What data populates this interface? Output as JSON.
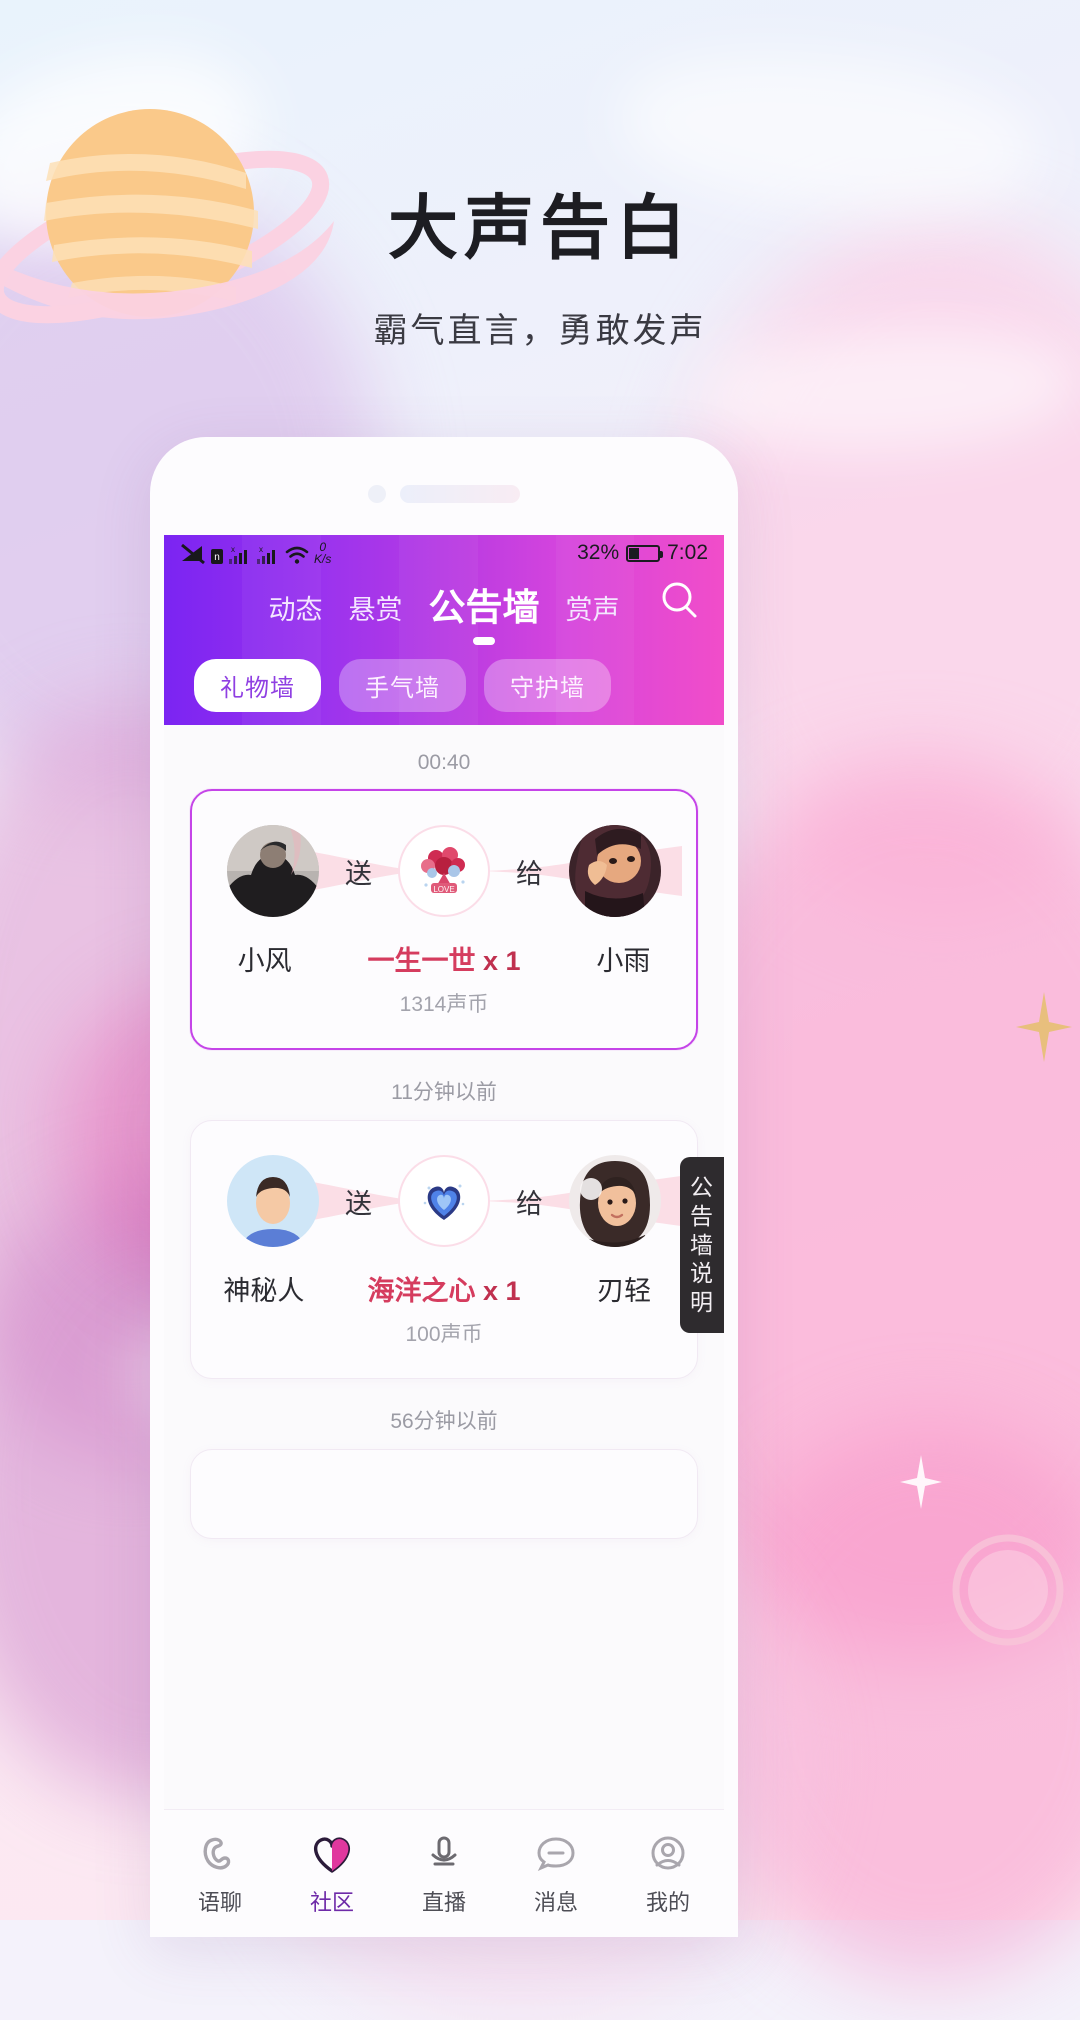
{
  "poster": {
    "headline": "大声告白",
    "subheadline": "霸气直言，勇敢发声"
  },
  "colors": {
    "header_start": "#7b24f2",
    "header_end": "#f14dc9",
    "accent_gift": "#d53c5e",
    "chip_active_text": "#8f3fe2",
    "active_tab": "#6e2aa8",
    "card_highlight_border": "#c544e8",
    "sidetab_bg": "#2e2b2e"
  },
  "statusbar": {
    "icons": [
      "signal-off-icon",
      "data-icon",
      "signal-bars-1-icon",
      "signal-bars-2-icon",
      "wifi-icon"
    ],
    "net_speed": "0",
    "net_speed_unit": "K/s",
    "battery_percent": "32%",
    "battery_icon": "battery-icon",
    "time": "7:02"
  },
  "header": {
    "tabs": [
      {
        "label": "动态",
        "active": false
      },
      {
        "label": "悬赏",
        "active": false
      },
      {
        "label": "公告墙",
        "active": true
      },
      {
        "label": "赏声",
        "active": false
      }
    ],
    "search_icon": "search-icon",
    "chips": [
      {
        "label": "礼物墙",
        "active": true
      },
      {
        "label": "手气墙",
        "active": false
      },
      {
        "label": "守护墙",
        "active": false
      }
    ]
  },
  "side_tab": {
    "chars": [
      "公",
      "告",
      "墙",
      "说",
      "明"
    ]
  },
  "feed": [
    {
      "timestamp": "00:40",
      "highlight": true,
      "sender": "小风",
      "sender_avatar": "avatar-photo-man",
      "verb_send": "送",
      "verb_to": "给",
      "gift_icon": "gift-bouquet-icon",
      "gift_name": "一生一世",
      "gift_qty": "x 1",
      "gift_cost": "1314声币",
      "receiver": "小雨",
      "receiver_avatar": "avatar-photo-woman"
    },
    {
      "timestamp": "11分钟以前",
      "highlight": false,
      "sender": "神秘人",
      "sender_avatar": "avatar-default-man",
      "verb_send": "送",
      "verb_to": "给",
      "gift_icon": "gift-heart-icon",
      "gift_name": "海洋之心",
      "gift_qty": "x 1",
      "gift_cost": "100声币",
      "receiver": "刃轻",
      "receiver_avatar": "avatar-photo-curly"
    }
  ],
  "feed_trailing_timestamp": "56分钟以前",
  "bottom_nav": [
    {
      "label": "语聊",
      "icon": "voice-call-icon",
      "active": false
    },
    {
      "label": "社区",
      "icon": "heart-icon",
      "active": true
    },
    {
      "label": "直播",
      "icon": "microphone-icon",
      "active": false
    },
    {
      "label": "消息",
      "icon": "message-icon",
      "active": false
    },
    {
      "label": "我的",
      "icon": "profile-icon",
      "active": false
    }
  ]
}
